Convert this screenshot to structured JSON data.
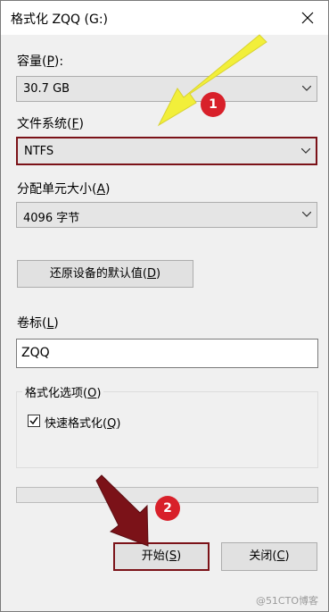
{
  "window": {
    "title": "格式化 ZQQ (G:)"
  },
  "capacity": {
    "label": "容量(",
    "key": "P",
    "label_end": "):",
    "value": "30.7 GB"
  },
  "filesystem": {
    "label": "文件系统(",
    "key": "F",
    "label_end": ")",
    "value": "NTFS"
  },
  "allocation": {
    "label": "分配单元大小(",
    "key": "A",
    "label_end": ")",
    "value": "4096 字节"
  },
  "restore": {
    "label": "还原设备的默认值(",
    "key": "D",
    "label_end": ")"
  },
  "volume": {
    "label": "卷标(",
    "key": "L",
    "label_end": ")",
    "value": "ZQQ"
  },
  "options": {
    "label": "格式化选项(",
    "key": "O",
    "label_end": ")",
    "quick_label": "快速格式化(",
    "quick_key": "Q",
    "quick_end": ")",
    "quick_checked": true
  },
  "progress": {
    "value": 0
  },
  "buttons": {
    "start": {
      "label": "开始(",
      "key": "S",
      "end": ")"
    },
    "close": {
      "label": "关闭(",
      "key": "C",
      "end": ")"
    }
  },
  "annotations": {
    "badge1": "1",
    "badge2": "2"
  },
  "watermark": "@51CTO博客",
  "colors": {
    "highlight_border": "#7b1218",
    "badge": "#d8202a",
    "arrow1": "#f2ef3a",
    "arrow2": "#7b1218"
  }
}
